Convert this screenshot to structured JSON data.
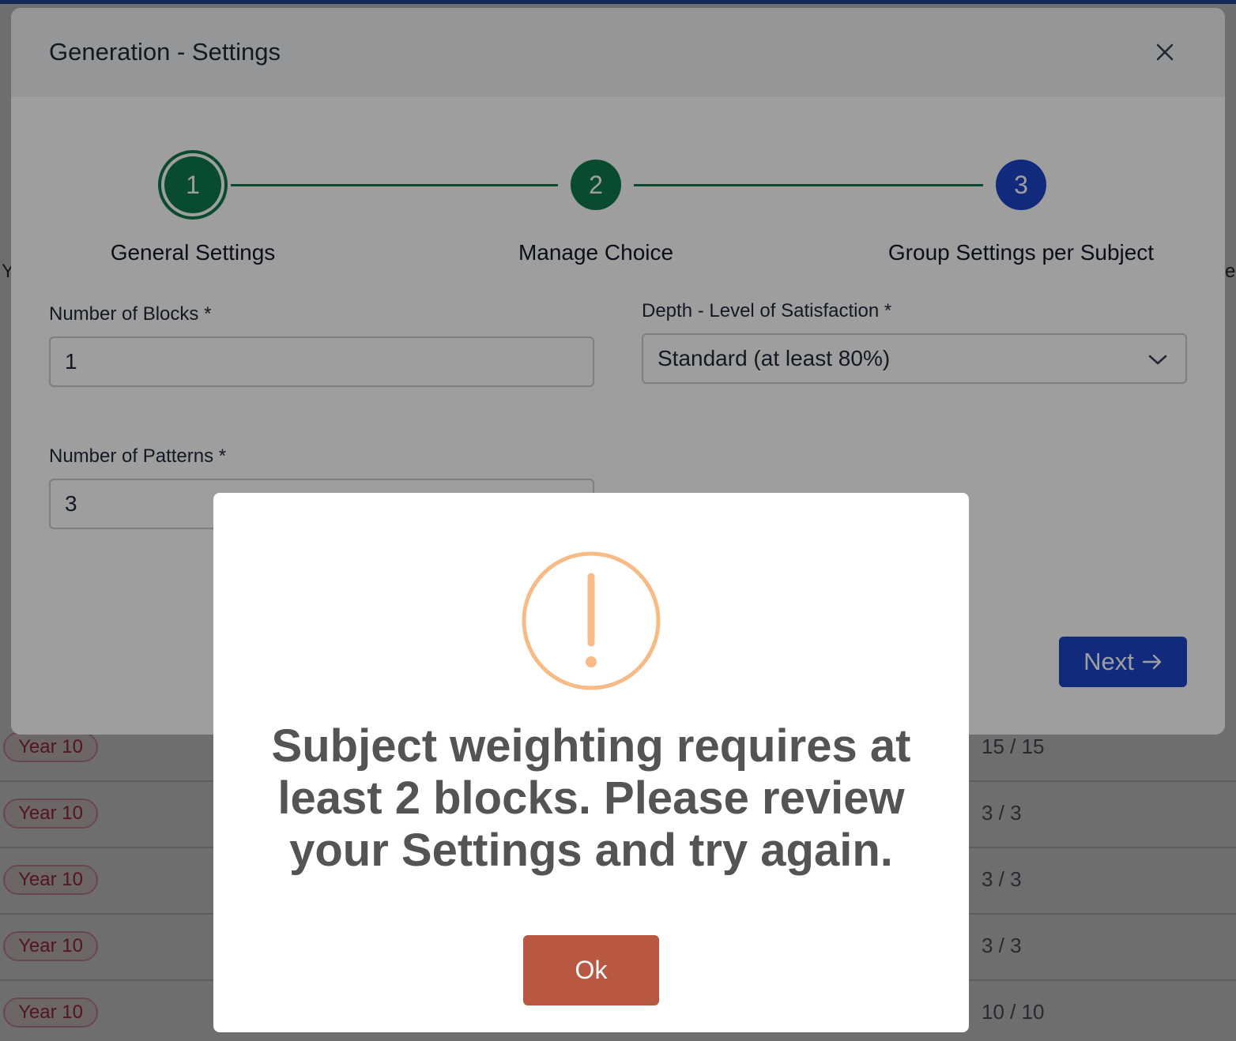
{
  "background": {
    "edge_left_text": "Y",
    "edge_right_text": "e",
    "rows": [
      {
        "badge": "Year 10",
        "count": "15 / 15"
      },
      {
        "badge": "Year 10",
        "count": "3 / 3"
      },
      {
        "badge": "Year 10",
        "count": "3 / 3"
      },
      {
        "badge": "Year 10",
        "count": "3 / 3"
      },
      {
        "badge": "Year 10",
        "count": "10 / 10"
      }
    ]
  },
  "modal": {
    "title": "Generation - Settings",
    "steps": [
      {
        "number": "1",
        "label": "General Settings",
        "color": "#0f7a4c"
      },
      {
        "number": "2",
        "label": "Manage Choice",
        "color": "#0f7a4c"
      },
      {
        "number": "3",
        "label": "Group Settings per Subject",
        "color": "#1e45c8"
      }
    ],
    "fields": {
      "blocks": {
        "label": "Number of Blocks *",
        "value": "1"
      },
      "depth": {
        "label": "Depth - Level of Satisfaction *",
        "value": "Standard (at least 80%)"
      },
      "patterns": {
        "label": "Number of Patterns *",
        "value": "3"
      }
    },
    "next_label": "Next"
  },
  "alert": {
    "message": "Subject weighting requires at least 2 blocks. Please review your Settings and try again.",
    "ok_label": "Ok",
    "icon_color": "#f8bb86",
    "ok_color": "#b85742"
  }
}
